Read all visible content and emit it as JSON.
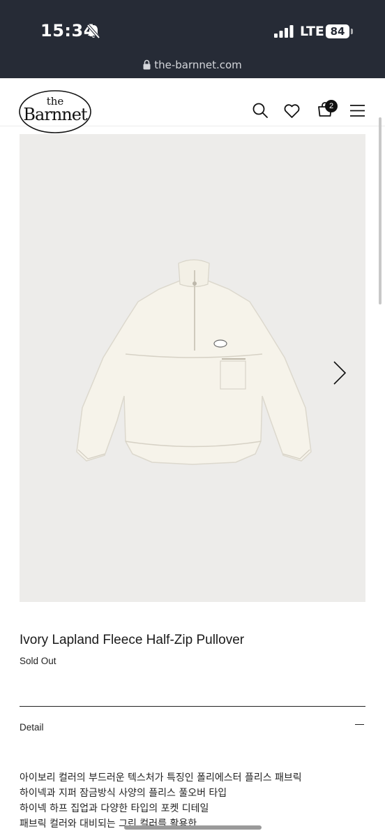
{
  "status_bar": {
    "time": "15:34",
    "network": "LTE",
    "battery": "84",
    "url": "the-barnnet.com"
  },
  "header": {
    "logo_top": "the",
    "logo_bottom": "Barnnet",
    "cart_count": "2",
    "icons": [
      "search-icon",
      "heart-icon",
      "cart-icon",
      "menu-icon"
    ]
  },
  "product": {
    "title": "Ivory Lapland Fleece Half-Zip Pullover",
    "stock_status": "Sold Out",
    "detail_label": "Detail",
    "description": [
      "아이보리 컬러의 부드러운 텍스처가 특징인 폴리에스터 플리스 패브릭",
      "하이넥과 지퍼 잠금방식 사양의 플리스 풀오버 타입",
      "하이넥 하프 집업과 다양한 타입의 포켓 디테일",
      "패브릭 컬러와 대비되는 그린 컬러를 활용한"
    ]
  },
  "colors": {
    "status_bar_bg": "#262b36",
    "image_bg": "#edecea",
    "garment": "#f5f2e9"
  }
}
